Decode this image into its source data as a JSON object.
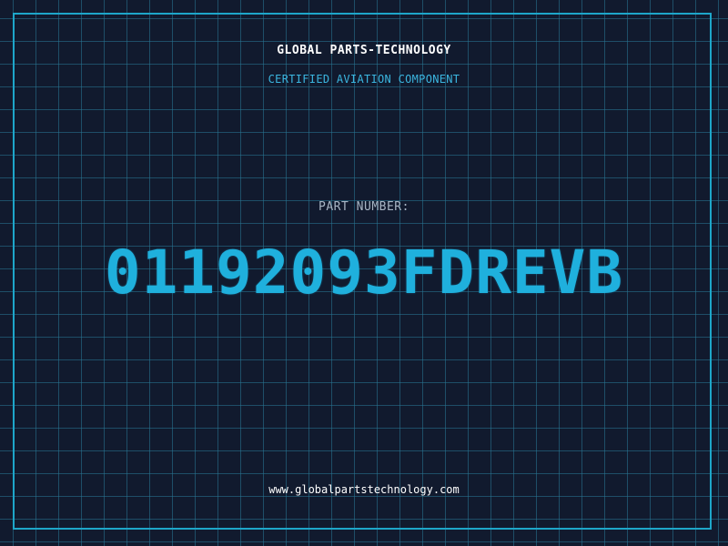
{
  "header": {
    "company": "GLOBAL PARTS-TECHNOLOGY",
    "subtitle": "CERTIFIED AVIATION COMPONENT"
  },
  "part": {
    "label": "PART NUMBER:",
    "number": "01192093FDREVB"
  },
  "footer": {
    "website": "www.globalpartstechnology.com"
  },
  "colors": {
    "background": "#111a2e",
    "grid": "#28789a",
    "frame": "#1ea6c9",
    "accent": "#1fb0dd",
    "label": "#a8b5c4",
    "text": "#ffffff"
  }
}
